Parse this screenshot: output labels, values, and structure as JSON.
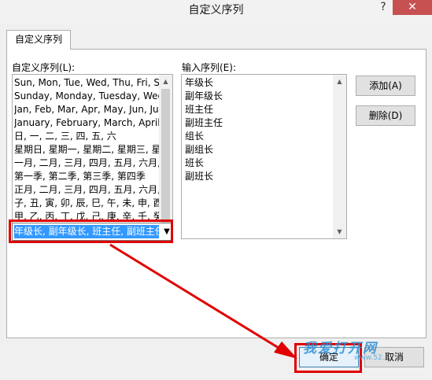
{
  "window": {
    "title": "自定义序列",
    "help_glyph": "?",
    "close_glyph": "✕"
  },
  "tab": {
    "label": "自定义序列"
  },
  "left": {
    "label": "自定义序列(L):",
    "items": [
      "Sun, Mon, Tue, Wed, Thu, Fri, Sat",
      "Sunday, Monday, Tuesday, Wednesday",
      "Jan, Feb, Mar, Apr, May, Jun, Jul",
      "January, February, March, April",
      "日, 一, 二, 三, 四, 五, 六",
      "星期日, 星期一, 星期二, 星期三, 星",
      "一月, 二月, 三月, 四月, 五月, 六月,",
      "第一季, 第二季, 第三季, 第四季",
      "正月, 二月, 三月, 四月, 五月, 六月,",
      "子, 丑, 寅, 卯, 辰, 巳, 午, 未, 申, 酉",
      "甲, 乙, 丙, 丁, 戊, 己, 庚, 辛, 壬, 癸"
    ],
    "selected_item": "年级长, 副年级长, 班主任, 副班主任"
  },
  "right": {
    "label": "输入序列(E):",
    "items": [
      "年级长",
      "副年级长",
      "班主任",
      "副班主任",
      "组长",
      "副组长",
      "班长",
      "副班长"
    ]
  },
  "buttons": {
    "add": "添加(A)",
    "delete": "删除(D)",
    "ok": "确定",
    "cancel": "取消"
  },
  "icons": {
    "scroll_up": "▲",
    "scroll_down": "▼",
    "dropdown": "▼"
  },
  "watermark": {
    "text": "我爱打开网",
    "sub": "www.52..."
  },
  "colors": {
    "selection": "#3399ff",
    "highlight_box": "#e00000",
    "close_button": "#c75050",
    "annotation_arrow": "#e00000"
  }
}
